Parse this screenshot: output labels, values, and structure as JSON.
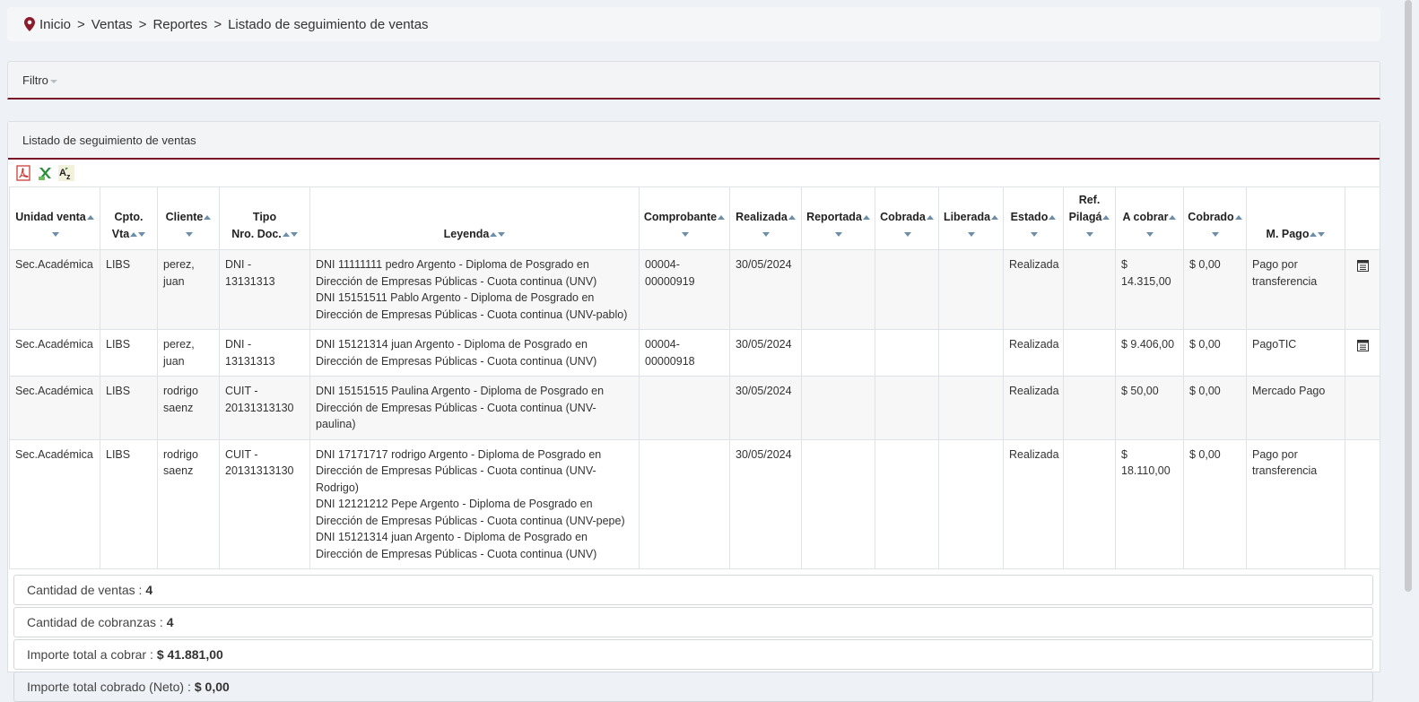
{
  "breadcrumb": {
    "items": [
      "Inicio",
      "Ventas",
      "Reportes",
      "Listado de seguimiento de ventas"
    ],
    "separator": ">"
  },
  "filter_panel": {
    "title": "Filtro"
  },
  "list_panel": {
    "title": "Listado de seguimiento de ventas"
  },
  "toolbar": {
    "icons": [
      "pdf-export-icon",
      "excel-export-icon",
      "sort-az-icon"
    ]
  },
  "table": {
    "headers": {
      "unidad": "Unidad venta",
      "cpto_1": "Cpto.",
      "cpto_2": "Vta",
      "cliente": "Cliente",
      "tipo_1": "Tipo",
      "tipo_2": "Nro. Doc.",
      "leyenda": "Leyenda",
      "comprobante": "Comprobante",
      "realizada": "Realizada",
      "reportada": "Reportada",
      "cobrada": "Cobrada",
      "liberada": "Liberada",
      "estado": "Estado",
      "ref_1": "Ref.",
      "ref_2": "Pilagá",
      "a_cobrar": "A cobrar",
      "cobrado": "Cobrado",
      "m_pago": "M. Pago"
    },
    "rows": [
      {
        "unidad": "Sec.Académica",
        "cpto": "LIBS",
        "cliente": "perez, juan",
        "tipo": "DNI - 13131313",
        "leyenda_1": "DNI 11111111 pedro Argento - Diploma de Posgrado en Dirección de Empresas Públicas - Cuota continua (UNV)",
        "leyenda_2": "DNI 15151511 Pablo Argento - Diploma de Posgrado en Dirección de Empresas Públicas - Cuota continua (UNV-pablo)",
        "leyenda_3": "",
        "comprobante": "00004-00000919",
        "realizada": "30/05/2024",
        "reportada": "",
        "cobrada": "",
        "liberada": "",
        "estado": "Realizada",
        "ref": "",
        "a_cobrar": "$ 14.315,00",
        "cobrado": "$ 0,00",
        "m_pago": "Pago por transferencia",
        "detail": true
      },
      {
        "unidad": "Sec.Académica",
        "cpto": "LIBS",
        "cliente": "perez, juan",
        "tipo": "DNI - 13131313",
        "leyenda_1": "DNI 15121314 juan Argento - Diploma de Posgrado en Dirección de Empresas Públicas - Cuota continua (UNV)",
        "leyenda_2": "",
        "leyenda_3": "",
        "comprobante": "00004-00000918",
        "realizada": "30/05/2024",
        "reportada": "",
        "cobrada": "",
        "liberada": "",
        "estado": "Realizada",
        "ref": "",
        "a_cobrar": "$ 9.406,00",
        "cobrado": "$ 0,00",
        "m_pago": "PagoTIC",
        "detail": true
      },
      {
        "unidad": "Sec.Académica",
        "cpto": "LIBS",
        "cliente": "rodrigo saenz",
        "tipo": "CUIT - 20131313130",
        "leyenda_1": "DNI 15151515 Paulina Argento - Diploma de Posgrado en Dirección de Empresas Públicas - Cuota continua (UNV-paulina)",
        "leyenda_2": "",
        "leyenda_3": "",
        "comprobante": "",
        "realizada": "30/05/2024",
        "reportada": "",
        "cobrada": "",
        "liberada": "",
        "estado": "Realizada",
        "ref": "",
        "a_cobrar": "$ 50,00",
        "cobrado": "$ 0,00",
        "m_pago": "Mercado Pago",
        "detail": false
      },
      {
        "unidad": "Sec.Académica",
        "cpto": "LIBS",
        "cliente": "rodrigo saenz",
        "tipo": "CUIT - 20131313130",
        "leyenda_1": "DNI 17171717 rodrigo Argento - Diploma de Posgrado en Dirección de Empresas Públicas - Cuota continua (UNV-Rodrigo)",
        "leyenda_2": "DNI 12121212 Pepe Argento - Diploma de Posgrado en Dirección de Empresas Públicas - Cuota continua (UNV-pepe)",
        "leyenda_3": "DNI 15121314 juan Argento - Diploma de Posgrado en Dirección de Empresas Públicas - Cuota continua (UNV)",
        "comprobante": "",
        "realizada": "30/05/2024",
        "reportada": "",
        "cobrada": "",
        "liberada": "",
        "estado": "Realizada",
        "ref": "",
        "a_cobrar": "$ 18.110,00",
        "cobrado": "$ 0,00",
        "m_pago": "Pago por transferencia",
        "detail": false
      }
    ]
  },
  "summary": [
    {
      "label": "Cantidad de ventas :",
      "value": "4"
    },
    {
      "label": "Cantidad de cobranzas :",
      "value": "4"
    },
    {
      "label": "Importe total a cobrar :",
      "value": "$ 41.881,00"
    },
    {
      "label": "Importe total cobrado (Neto) :",
      "value": "$ 0,00"
    }
  ],
  "colors": {
    "accent": "#7a1628",
    "sort_arrow": "#6d8ea8",
    "pin": "#8b1c2c"
  }
}
